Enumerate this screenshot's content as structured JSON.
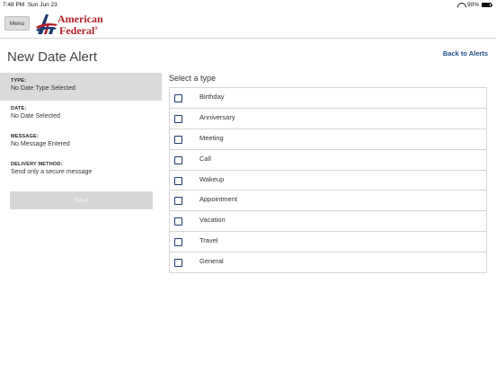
{
  "status_bar": {
    "time": "7:48 PM",
    "date": "Sun Jun 23",
    "battery_text": "90%",
    "battery_level": 0.9,
    "icons": [
      "wifi-icon",
      "battery-icon"
    ]
  },
  "header": {
    "menu_label": "Menu",
    "logo_line1": "American",
    "logo_line2": "Federal",
    "logo_mark": "®",
    "brand_color": "#b3202a",
    "brand_blue": "#1e3a6e"
  },
  "page": {
    "title": "New Date Alert",
    "back_label": "Back to Alerts"
  },
  "summary": {
    "type": {
      "label": "TYPE:",
      "value": "No Date Type Selected"
    },
    "date": {
      "label": "DATE:",
      "value": "No Date Selected"
    },
    "message": {
      "label": "MESSAGE:",
      "value": "No Message Entered"
    },
    "delivery": {
      "label": "DELIVERY METHOD:",
      "value": "Send only a secure message"
    },
    "save_label": "Save"
  },
  "type_panel": {
    "heading": "Select a type",
    "types": [
      "Birthday",
      "Anniversary",
      "Meeting",
      "Call",
      "Wakeup",
      "Appointment",
      "Vacation",
      "Travel",
      "General"
    ]
  }
}
